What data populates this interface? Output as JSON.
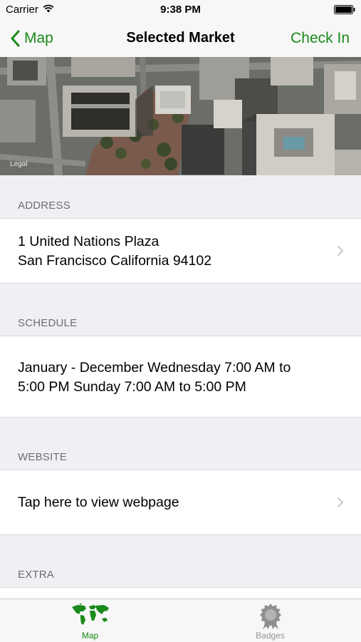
{
  "status_bar": {
    "carrier": "Carrier",
    "time": "9:38 PM"
  },
  "nav": {
    "back_label": "Map",
    "title": "Selected Market",
    "checkin_label": "Check In"
  },
  "map": {
    "legal_label": "Legal"
  },
  "sections": {
    "address": {
      "header": "ADDRESS",
      "line1": "1 United Nations Plaza",
      "line2": "San Francisco California 94102"
    },
    "schedule": {
      "header": "SCHEDULE",
      "line1": "January - December Wednesday 7:00 AM to",
      "line2": "5:00 PM Sunday 7:00 AM to 5:00 PM"
    },
    "website": {
      "header": "WEBSITE",
      "link_text": "Tap here to view webpage"
    },
    "extra": {
      "header": "EXTRA"
    }
  },
  "tabbar": {
    "tabs": [
      {
        "label": "Map",
        "icon": "world-map-icon",
        "selected": true
      },
      {
        "label": "Badges",
        "icon": "badge-icon",
        "selected": false
      }
    ]
  },
  "colors": {
    "accent": "#1a8a1a",
    "inactive": "#929292",
    "group_background": "#efeff4"
  }
}
